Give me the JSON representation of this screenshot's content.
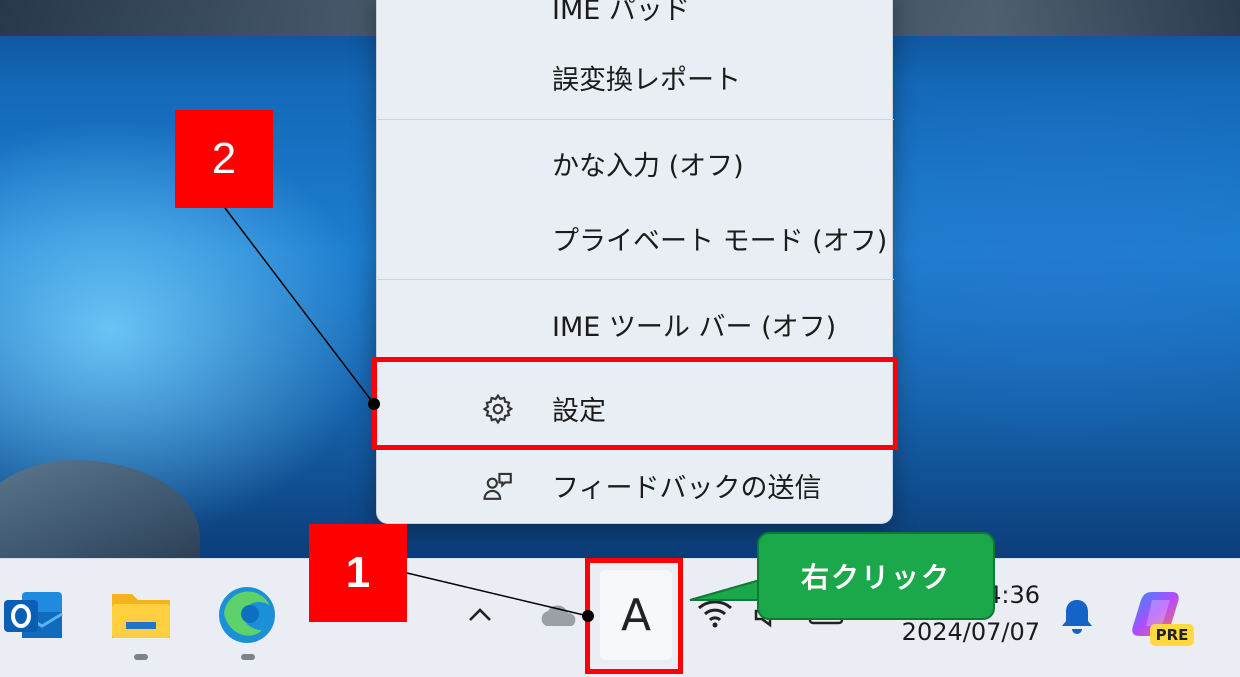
{
  "context_menu": {
    "items_top_partial": "IME パッド",
    "item_report": "誤変換レポート",
    "item_kana": "かな入力 (オフ)",
    "item_private": "プライベート モード (オフ)",
    "item_toolbar": "IME ツール バー (オフ)",
    "item_settings": "設定",
    "item_feedback": "フィードバックの送信",
    "icons": {
      "settings": "gear-icon",
      "feedback": "feedback-icon"
    }
  },
  "annotations": {
    "step1": "1",
    "step2": "2",
    "bubble": "右クリック",
    "colors": {
      "callout": "#ff0000",
      "bubble": "#1aa84a"
    }
  },
  "taskbar": {
    "ime_mode": "A",
    "clock_time": "4:36",
    "clock_date": "2024/07/07",
    "copilot_badge": "PRE",
    "icons": [
      "outlook-icon",
      "file-explorer-icon",
      "edge-icon",
      "chevron-up-icon",
      "onedrive-icon",
      "ime-indicator",
      "wifi-icon",
      "speaker-icon",
      "battery-icon",
      "bell-icon",
      "copilot-icon"
    ]
  }
}
